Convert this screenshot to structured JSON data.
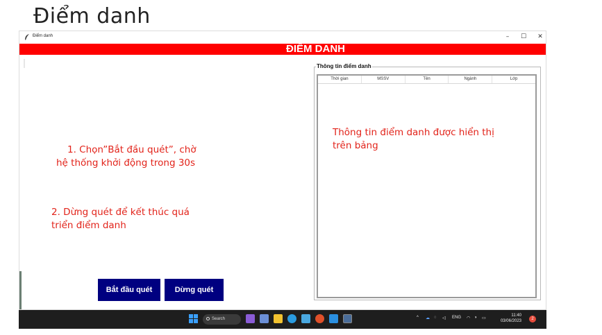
{
  "slide": {
    "title": "Điểm danh"
  },
  "window": {
    "title": "Điểm danh",
    "controls": {
      "minimize": "–",
      "maximize": "☐",
      "close": "✕"
    }
  },
  "app": {
    "header": "ĐIỂM DANH",
    "group_title": "Thông tin điểm danh",
    "table_columns": [
      "Thời gian",
      "MSSV",
      "Tên",
      "Ngành",
      "Lớp"
    ],
    "buttons": {
      "start": "Bắt đầu quét",
      "stop": "Dừng quét"
    }
  },
  "annotations": {
    "note1_line1": "1. Chọn”Bắt đầu quét”, chờ",
    "note1_line2": "hệ thống khởi động trong 30s",
    "note2_line1": "2. Dừng quét để kết thúc quá",
    "note2_line2": "triển điểm danh",
    "note3_line1": "Thông tin điểm danh được hiển thị",
    "note3_line2": "trên bảng"
  },
  "taskbar": {
    "search_label": "Search",
    "tray_language": "ENG",
    "time": "11:40",
    "date": "03/06/2023",
    "notification_count": "2"
  },
  "colors": {
    "header": "#ff0000",
    "button": "#000080",
    "annotation": "#e2231a",
    "taskbar": "#1e1e1e"
  }
}
